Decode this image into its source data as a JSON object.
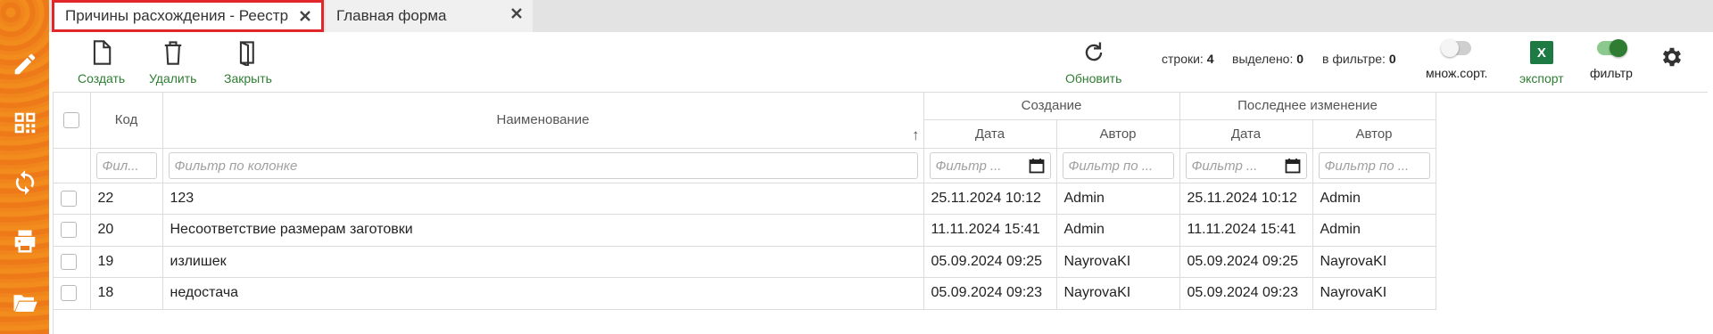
{
  "tabs": [
    {
      "label": "Причины расхождения - Реестр",
      "active": true
    },
    {
      "label": "Главная форма",
      "active": false
    }
  ],
  "sidebar": {
    "icons": [
      "pencil-icon",
      "qr-code-icon",
      "sync-icon",
      "printer-icon",
      "folder-open-icon"
    ]
  },
  "toolbar": {
    "create_label": "Создать",
    "delete_label": "Удалить",
    "close_label": "Закрыть",
    "refresh_label": "Обновить",
    "rows_label": "строки:",
    "rows_value": "4",
    "selected_label": "выделено:",
    "selected_value": "0",
    "filtered_label": "в фильтре:",
    "filtered_value": "0",
    "multisort_label": "множ.сорт.",
    "multisort_on": false,
    "export_label": "экспорт",
    "export_icon": "X",
    "filter_label": "фильтр",
    "filter_on": true
  },
  "grid": {
    "group_created": "Создание",
    "group_modified": "Последнее изменение",
    "col_code": "Код",
    "col_name": "Наименование",
    "col_name_sort": "↑",
    "col_date": "Дата",
    "col_author": "Автор",
    "filter_code_ph": "Фил...",
    "filter_name_ph": "Фильтр по колонке",
    "filter_date_ph": "Фильтр ...",
    "filter_author_ph": "Фильтр по ...",
    "rows": [
      {
        "code": "22",
        "name": "123",
        "created": "25.11.2024 10:12",
        "created_by": "Admin",
        "modified": "25.11.2024 10:12",
        "modified_by": "Admin"
      },
      {
        "code": "20",
        "name": "Несоответствие размерам заготовки",
        "created": "11.11.2024 15:41",
        "created_by": "Admin",
        "modified": "11.11.2024 15:41",
        "modified_by": "Admin"
      },
      {
        "code": "19",
        "name": "излишек",
        "created": "05.09.2024 09:25",
        "created_by": "NayrovaKI",
        "modified": "05.09.2024 09:25",
        "modified_by": "NayrovaKI"
      },
      {
        "code": "18",
        "name": "недостача",
        "created": "05.09.2024 09:23",
        "created_by": "NayrovaKI",
        "modified": "05.09.2024 09:23",
        "modified_by": "NayrovaKI"
      }
    ]
  },
  "colors": {
    "accent_green": "#2e7d32",
    "active_tab_border": "#e2262a",
    "sidebar_orange": "#f08a1d"
  }
}
